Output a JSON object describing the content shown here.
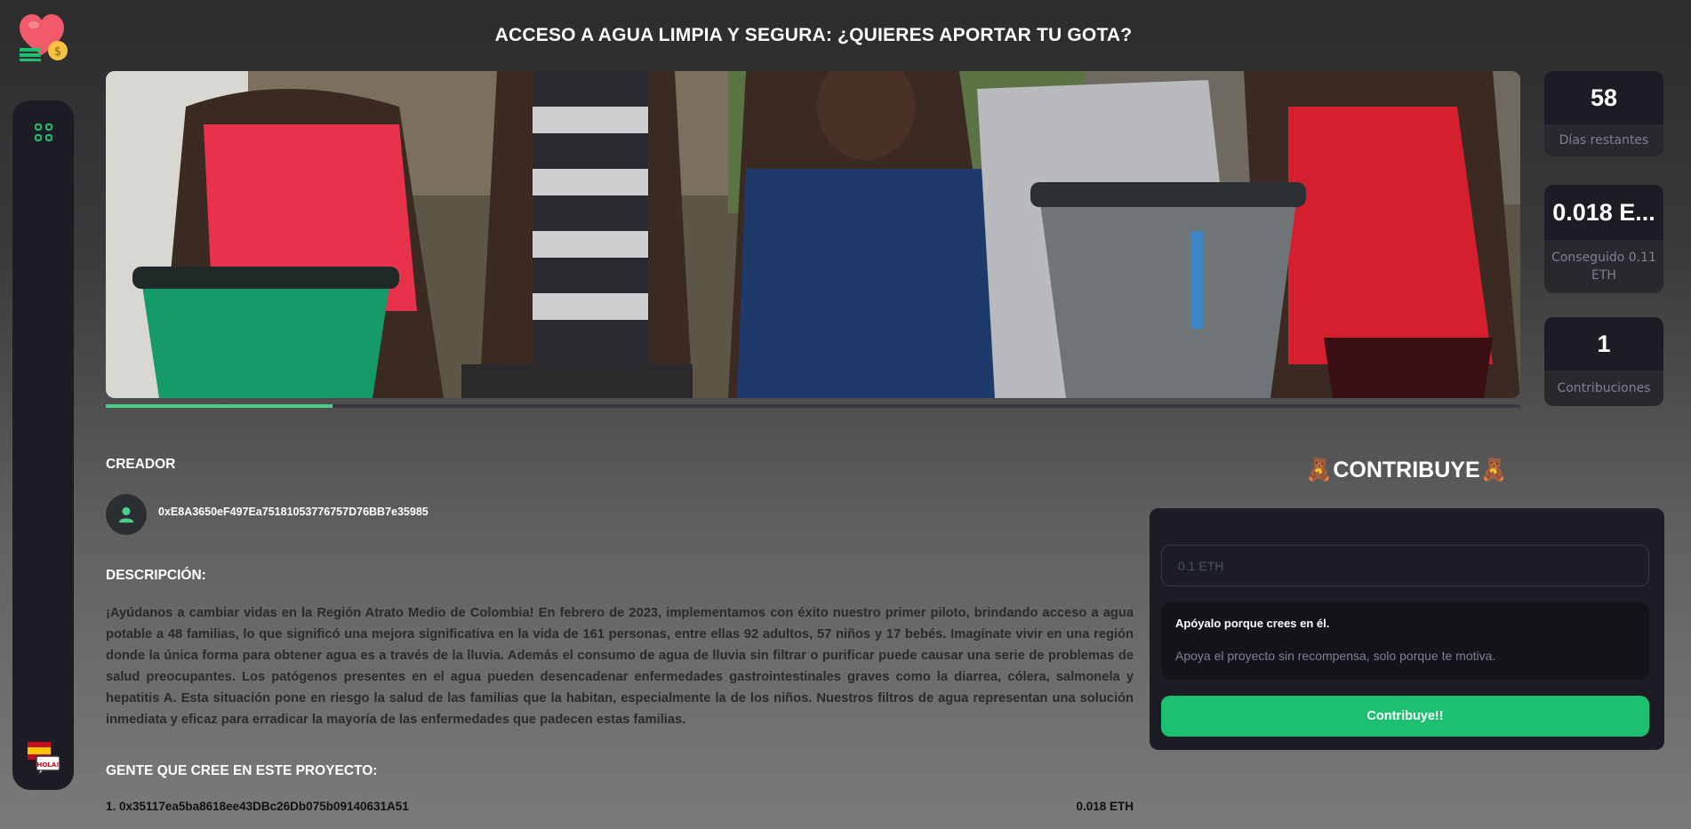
{
  "header": {
    "title": "ACCESO A AGUA LIMPIA Y SEGURA: ¿QUIERES APORTAR TU GOTA?"
  },
  "sidebar": {
    "items": [
      {
        "icon": "dashboard-grid-icon"
      },
      {
        "icon": "spanish-flag-icon"
      }
    ]
  },
  "hero": {
    "progress_fraction": 0.16
  },
  "stats": {
    "days_left_value": "58",
    "days_left_label": "Días restantes",
    "raised_value": "0.018 E...",
    "raised_label": "Conseguido 0.11 ETH",
    "contributions_value": "1",
    "contributions_label": "Contribuciones"
  },
  "creator": {
    "heading": "CREADOR",
    "address": "0xE8A3650eF497Ea75181053776757D76BB7e35985"
  },
  "description": {
    "heading": "DESCRIPCIÓN:",
    "text": "¡Ayúdanos a cambiar vidas en la Región Atrato Medio de Colombia! En febrero de 2023, implementamos con éxito nuestro primer piloto, brindando acceso a agua potable a 48 familias, lo que significó una mejora significativa en la vida de 161 personas, entre ellas 92 adultos, 57 niños y 17 bebés. Imagínate vivir en una región donde la única forma para obtener agua es a través de la lluvia. Además el consumo de agua de lluvia sin filtrar o purificar puede causar una serie de problemas de salud preocupantes. Los patógenos presentes en el agua pueden desencadenar enfermedades gastrointestinales graves como la diarrea, cólera, salmonela y hepatitis A. Esta situación pone en riesgo la salud de las familias que la habitan, especialmente la de los niños. Nuestros filtros de agua representan una solución inmediata y eficaz para erradicar la mayoría de las enfermedades que padecen estas familias."
  },
  "backers": {
    "heading": "GENTE QUE CREE EN ESTE PROYECTO:",
    "list": [
      {
        "label": "1. 0x35117ea5ba8618ee43DBc26Db075b09140631A51",
        "amount": "0.018 ETH"
      }
    ]
  },
  "contribute": {
    "title": "🧸CONTRIBUYE🧸",
    "input_placeholder": "0.1 ETH",
    "info_heading": "Apóyalo porque crees en él.",
    "info_text": "Apoya el proyecto sin recompensa, solo porque te motiva.",
    "button_label": "Contribuye!!"
  },
  "colors": {
    "accent": "#1dc071",
    "progress": "#4acd8d",
    "card_dark": "#1c1c24",
    "card_label": "#28282e",
    "muted_text": "#808191"
  }
}
